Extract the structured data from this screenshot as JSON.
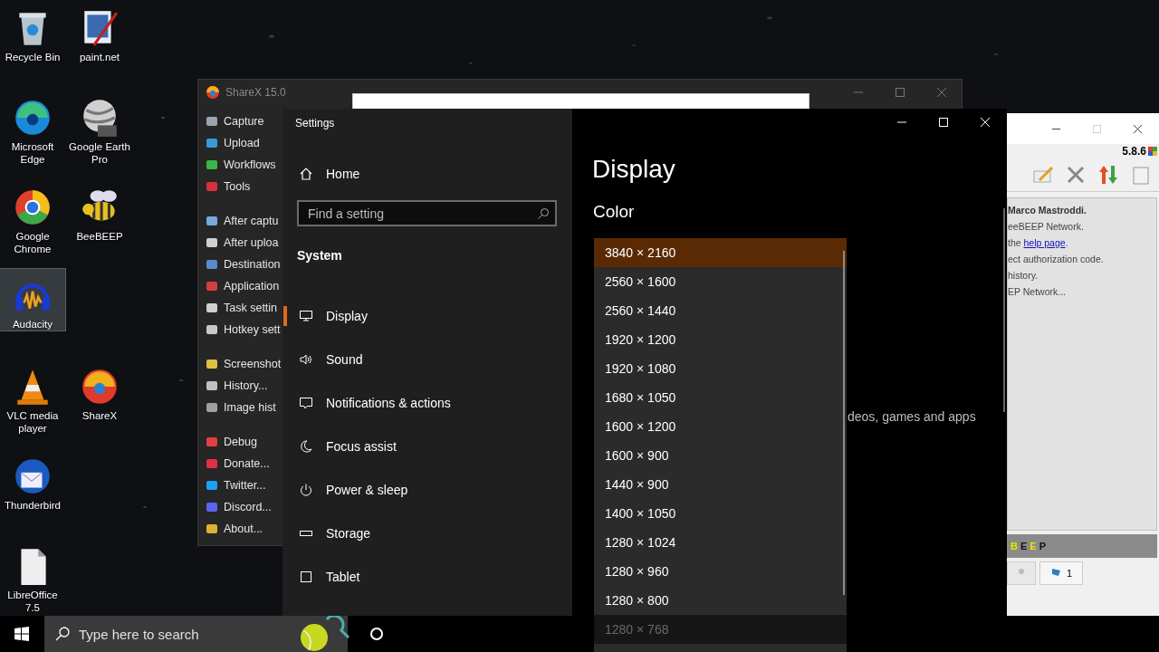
{
  "desktop_icons": [
    {
      "label": "Recycle Bin",
      "selected": false
    },
    {
      "label": "paint.net",
      "selected": false
    },
    {
      "label": "Microsoft Edge",
      "selected": false
    },
    {
      "label": "Google Earth Pro",
      "selected": false
    },
    {
      "label": "Google Chrome",
      "selected": false
    },
    {
      "label": "BeeBEEP",
      "selected": false
    },
    {
      "label": "Audacity",
      "selected": true
    },
    {
      "label": "VLC media player",
      "selected": false
    },
    {
      "label": "ShareX",
      "selected": false
    },
    {
      "label": "Thunderbird",
      "selected": false
    },
    {
      "label": "LibreOffice 7.5",
      "selected": false
    }
  ],
  "sharex_window": {
    "title": "ShareX 15.0",
    "menu_groups": [
      [
        "Capture",
        "Upload",
        "Workflows",
        "Tools"
      ],
      [
        "After captu",
        "After uploa",
        "Destination",
        "Application",
        "Task settin",
        "Hotkey sett"
      ],
      [
        "Screenshot",
        "History...",
        "Image hist"
      ],
      [
        "Debug",
        "Donate...",
        "Twitter...",
        "Discord...",
        "About..."
      ]
    ]
  },
  "beebeep_window": {
    "version": "5.8.6",
    "lines": [
      {
        "kind": "bold",
        "text": "Marco Mastroddi."
      },
      {
        "kind": "plain",
        "text": "eeBEEP Network."
      },
      {
        "kind": "link",
        "before": "the ",
        "link": "help page",
        "after": "."
      },
      {
        "kind": "plain",
        "text": "ect authorization code."
      },
      {
        "kind": "plain",
        "text": "history."
      },
      {
        "kind": "plain",
        "text": "EP Network..."
      }
    ],
    "banner_letters": [
      {
        "text": "B",
        "color": "#e6e600"
      },
      {
        "text": "E",
        "color": "#111111"
      },
      {
        "text": "E",
        "color": "#e6e600"
      },
      {
        "text": "P",
        "color": "#111111"
      }
    ],
    "tab_count": "1"
  },
  "settings_window": {
    "title": "Settings",
    "home": "Home",
    "search": {
      "placeholder": "Find a setting"
    },
    "section": "System",
    "nav": [
      {
        "label": "Display",
        "selected": true
      },
      {
        "label": "Sound",
        "selected": false
      },
      {
        "label": "Notifications & actions",
        "selected": false
      },
      {
        "label": "Focus assist",
        "selected": false
      },
      {
        "label": "Power & sleep",
        "selected": false
      },
      {
        "label": "Storage",
        "selected": false
      },
      {
        "label": "Tablet",
        "selected": false
      }
    ],
    "heading": "Display",
    "subheading": "Color",
    "background_text": "deos, games and apps",
    "resolutions": [
      {
        "label": "3840 × 2160",
        "selected": true,
        "faded": false
      },
      {
        "label": "2560 × 1600",
        "selected": false,
        "faded": false
      },
      {
        "label": "2560 × 1440",
        "selected": false,
        "faded": false
      },
      {
        "label": "1920 × 1200",
        "selected": false,
        "faded": false
      },
      {
        "label": "1920 × 1080",
        "selected": false,
        "faded": false
      },
      {
        "label": "1680 × 1050",
        "selected": false,
        "faded": false
      },
      {
        "label": "1600 × 1200",
        "selected": false,
        "faded": false
      },
      {
        "label": "1600 × 900",
        "selected": false,
        "faded": false
      },
      {
        "label": "1440 × 900",
        "selected": false,
        "faded": false
      },
      {
        "label": "1400 × 1050",
        "selected": false,
        "faded": false
      },
      {
        "label": "1280 × 1024",
        "selected": false,
        "faded": false
      },
      {
        "label": "1280 × 960",
        "selected": false,
        "faded": false
      },
      {
        "label": "1280 × 800",
        "selected": false,
        "faded": false
      },
      {
        "label": "1280 × 768",
        "selected": false,
        "faded": true
      }
    ]
  },
  "taskbar": {
    "search": {
      "placeholder": "Type here to search"
    }
  }
}
